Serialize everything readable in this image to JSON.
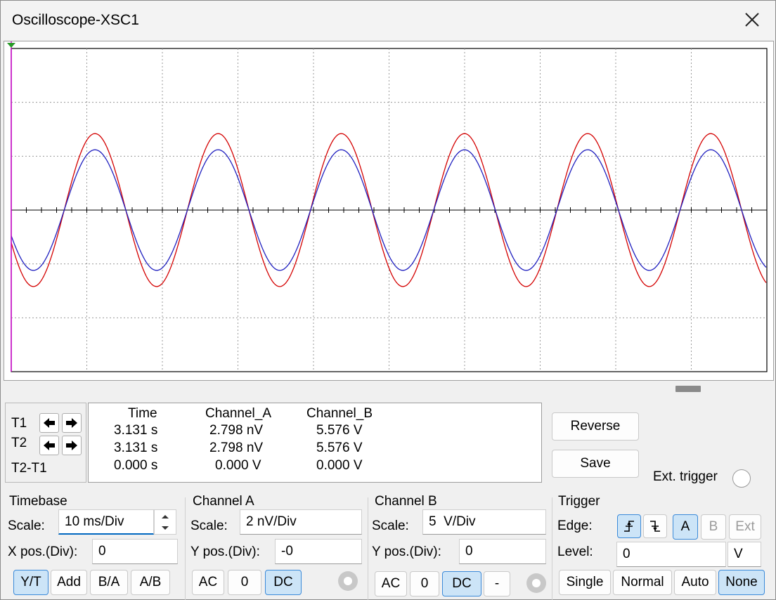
{
  "window": {
    "title": "Oscilloscope-XSC1"
  },
  "colors": {
    "channel_a": "#d40000",
    "channel_b": "#1f1fbf",
    "grid": "#9a9a9a",
    "cursor": "#cc00cc",
    "accent": "#cce4f7"
  },
  "cursors": {
    "t1_label": "T1",
    "t2_label": "T2",
    "t2t1_label": "T2-T1"
  },
  "readout": {
    "headers": {
      "time": "Time",
      "channel_a": "Channel_A",
      "channel_b": "Channel_B"
    },
    "t1": {
      "time": "3.131 s",
      "channel_a": "2.798 nV",
      "channel_b": "5.576 V"
    },
    "t2": {
      "time": "3.131 s",
      "channel_a": "2.798 nV",
      "channel_b": "5.576 V"
    },
    "diff": {
      "time": "0.000 s",
      "channel_a": "0.000 V",
      "channel_b": "0.000 V"
    }
  },
  "actions": {
    "reverse": "Reverse",
    "save": "Save",
    "ext_trigger": "Ext. trigger"
  },
  "timebase": {
    "title": "Timebase",
    "scale_label": "Scale:",
    "scale_value": "10 ms/Div",
    "xpos_label": "X pos.(Div):",
    "xpos_value": "0",
    "modes": [
      "Y/T",
      "Add",
      "B/A",
      "A/B"
    ],
    "active_mode": "Y/T"
  },
  "channel_a": {
    "title": "Channel A",
    "scale_label": "Scale:",
    "scale_value": "2 nV/Div",
    "ypos_label": "Y pos.(Div):",
    "ypos_value": "-0",
    "coupling": [
      "AC",
      "0",
      "DC"
    ],
    "active_coupling": "DC"
  },
  "channel_b": {
    "title": "Channel B",
    "scale_label": "Scale:",
    "scale_value": "5  V/Div",
    "ypos_label": "Y pos.(Div):",
    "ypos_value": "0",
    "coupling": [
      "AC",
      "0",
      "DC",
      "-"
    ],
    "active_coupling": "DC"
  },
  "trigger": {
    "title": "Trigger",
    "edge_label": "Edge:",
    "sources": [
      "A",
      "B",
      "Ext"
    ],
    "active_source": "A",
    "level_label": "Level:",
    "level_value": "0",
    "level_unit": "V",
    "modes": [
      "Single",
      "Normal",
      "Auto",
      "None"
    ],
    "active_mode": "None"
  },
  "chart_data": {
    "type": "line",
    "xlabel": "",
    "ylabel": "",
    "divisions": {
      "x": 10,
      "y": 6
    },
    "period_divs": 1.63,
    "series": [
      {
        "amplitude_divs": 1.42,
        "color": "#d40000"
      },
      {
        "amplitude_divs": 1.12,
        "color": "#1f1fbf"
      }
    ]
  }
}
